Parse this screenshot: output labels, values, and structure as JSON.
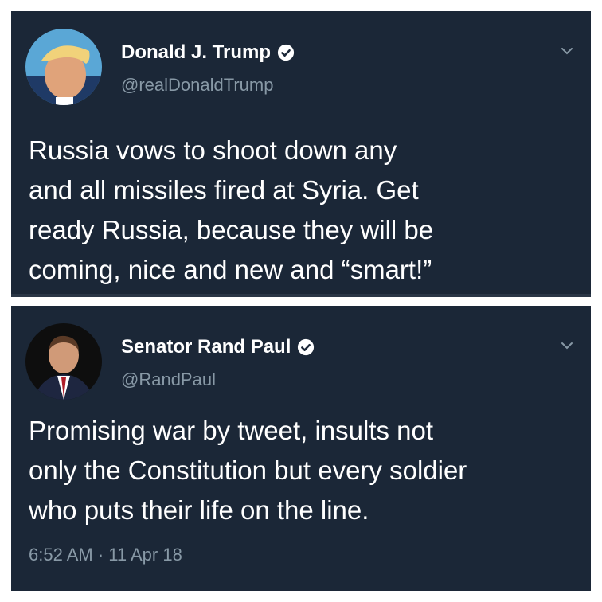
{
  "tweets": [
    {
      "name": "Donald J. Trump",
      "handle": "@realDonaldTrump",
      "verified": true,
      "avatar_icon": "profile-photo-icon",
      "text": "Russia vows to shoot down any\nand all missiles fired at Syria. Get\nready Russia,  because they will be\ncoming, nice and new and “smart!”"
    },
    {
      "name": "Senator Rand Paul",
      "handle": "@RandPaul",
      "verified": true,
      "avatar_icon": "profile-photo-icon",
      "text": "Promising war by tweet, insults not\nonly the Constitution but every soldier\nwho puts their life on the line.",
      "timestamp": "6:52 AM · 11 Apr 18"
    }
  ],
  "colors": {
    "panel_bg": "#1b2737",
    "text": "#ffffff",
    "muted": "#8899a6"
  }
}
